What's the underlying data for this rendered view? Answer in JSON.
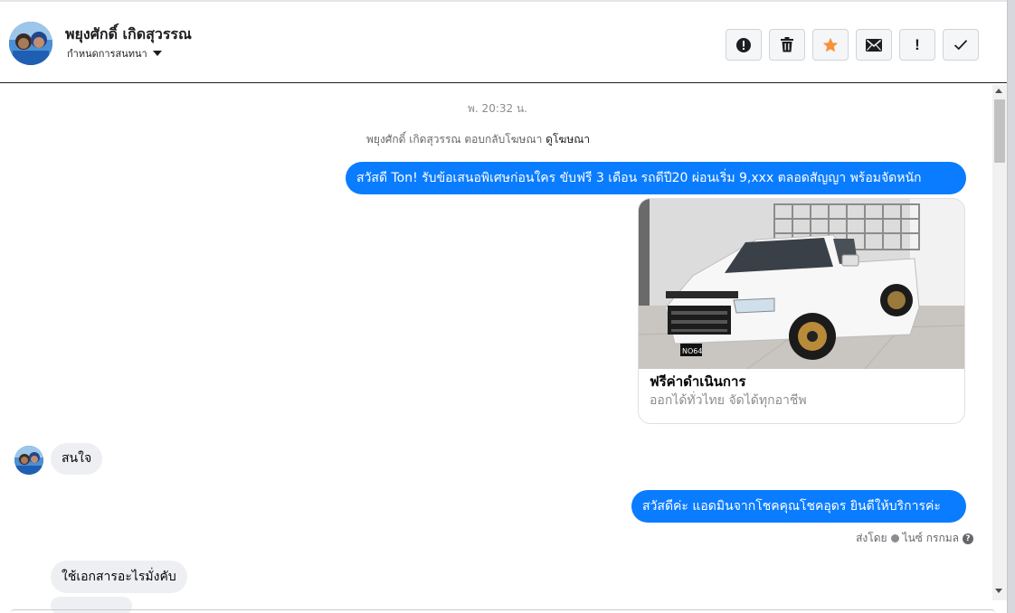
{
  "header": {
    "contact_name": "พยุงศักดิ์ เกิดสุวรรณ",
    "assign_label": "กำหนดการสนทนา",
    "actions": [
      {
        "id": "spam",
        "icon": "alert-circle-icon"
      },
      {
        "id": "delete",
        "icon": "trash-icon"
      },
      {
        "id": "star",
        "icon": "star-icon",
        "color": "#f7923a"
      },
      {
        "id": "mark-unread",
        "icon": "envelope-icon"
      },
      {
        "id": "follow-up",
        "icon": "exclamation-icon",
        "glyph": "!"
      },
      {
        "id": "done",
        "icon": "checkmark-icon"
      }
    ]
  },
  "thread": {
    "timestamp": "พ. 20:32 น.",
    "ad_reply_prefix": "พยุงศักดิ์ เกิดสุวรรณ ตอบกลับโฆษณา",
    "ad_link": "ดูโฆษณา",
    "messages": [
      {
        "direction": "out",
        "text": "สวัสดี Ton! รับข้อเสนอพิเศษก่อนใคร ขับฟรี 3 เดือน รถดีปี20 ผ่อนเริ่ม 9,xxx ตลอดสัญญา พร้อมจัดหนัก"
      },
      {
        "direction": "in",
        "text": "สนใจ"
      },
      {
        "direction": "out",
        "text": "สวัสดีค่ะ แอดมินจากโชคคุณโชคอุดร ยินดีให้บริการค่ะ"
      },
      {
        "direction": "in",
        "text": "ใช้เอกสารอะไรมั่งคับ"
      }
    ],
    "card": {
      "title": "ฟรีค่าดำเนินการ",
      "subtitle": "ออกได้ทั่วไทย จัดได้ทุกอาชีพ",
      "plate_text": "NO64"
    },
    "sent_by": {
      "label": "ส่งโดย",
      "name": "ไนซ์ กรกมล",
      "help": "?"
    }
  },
  "colors": {
    "outgoing_bubble": "#0a7cff",
    "incoming_bubble": "#eeeff2",
    "star": "#f7923a"
  }
}
